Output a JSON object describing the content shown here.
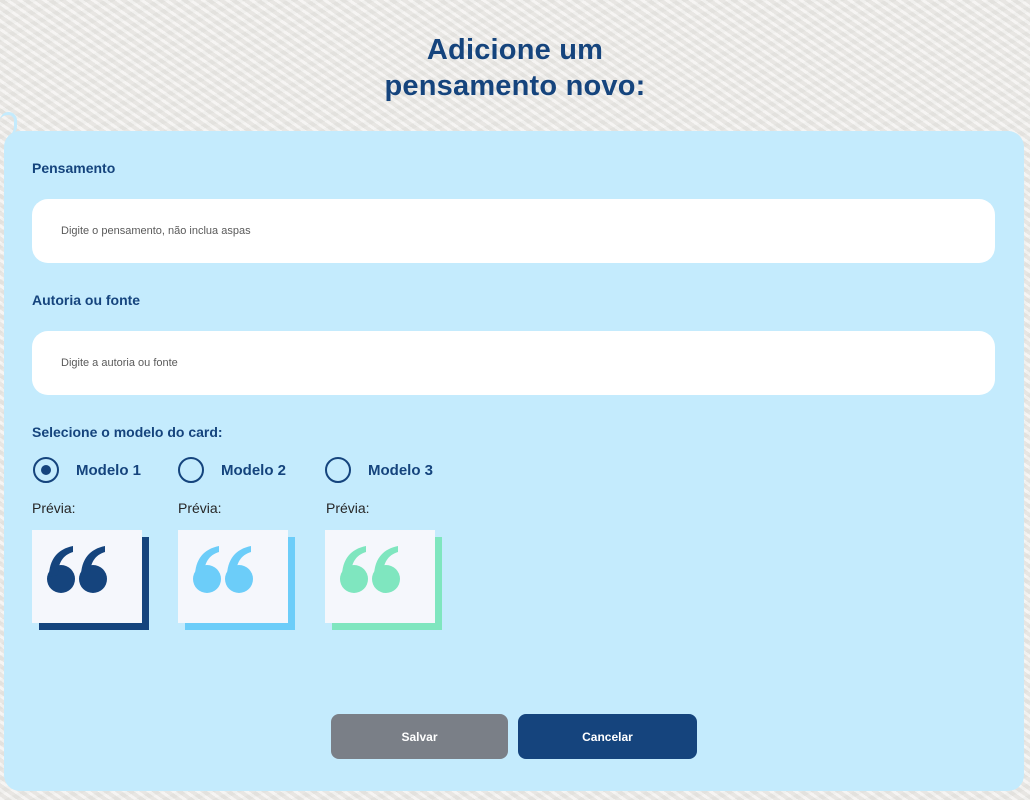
{
  "title": {
    "line1": "Adicione um",
    "line2": "pensamento novo:"
  },
  "form": {
    "thought": {
      "label": "Pensamento",
      "placeholder": "Digite o pensamento, não inclua aspas",
      "value": ""
    },
    "author": {
      "label": "Autoria ou fonte",
      "placeholder": "Digite a autoria ou fonte",
      "value": ""
    },
    "model": {
      "label": "Selecione o modelo do card:",
      "selected": "Modelo 1",
      "options": [
        {
          "label": "Modelo 1",
          "checked": true,
          "preview_label": "Prévia:",
          "accent_color": "#15447d",
          "icon": "quote-icon"
        },
        {
          "label": "Modelo 2",
          "checked": false,
          "preview_label": "Prévia:",
          "accent_color": "#6ccdf9",
          "icon": "quote-icon"
        },
        {
          "label": "Modelo 3",
          "checked": false,
          "preview_label": "Prévia:",
          "accent_color": "#7fe6bf",
          "icon": "quote-icon"
        }
      ]
    }
  },
  "buttons": {
    "save": "Salvar",
    "cancel": "Cancelar"
  },
  "colors": {
    "primary": "#15447d",
    "panel_background": "#c4ebfd",
    "save_button": "#7a7f87",
    "cancel_button": "#15447d",
    "preview_background": "#f5f7fc"
  }
}
